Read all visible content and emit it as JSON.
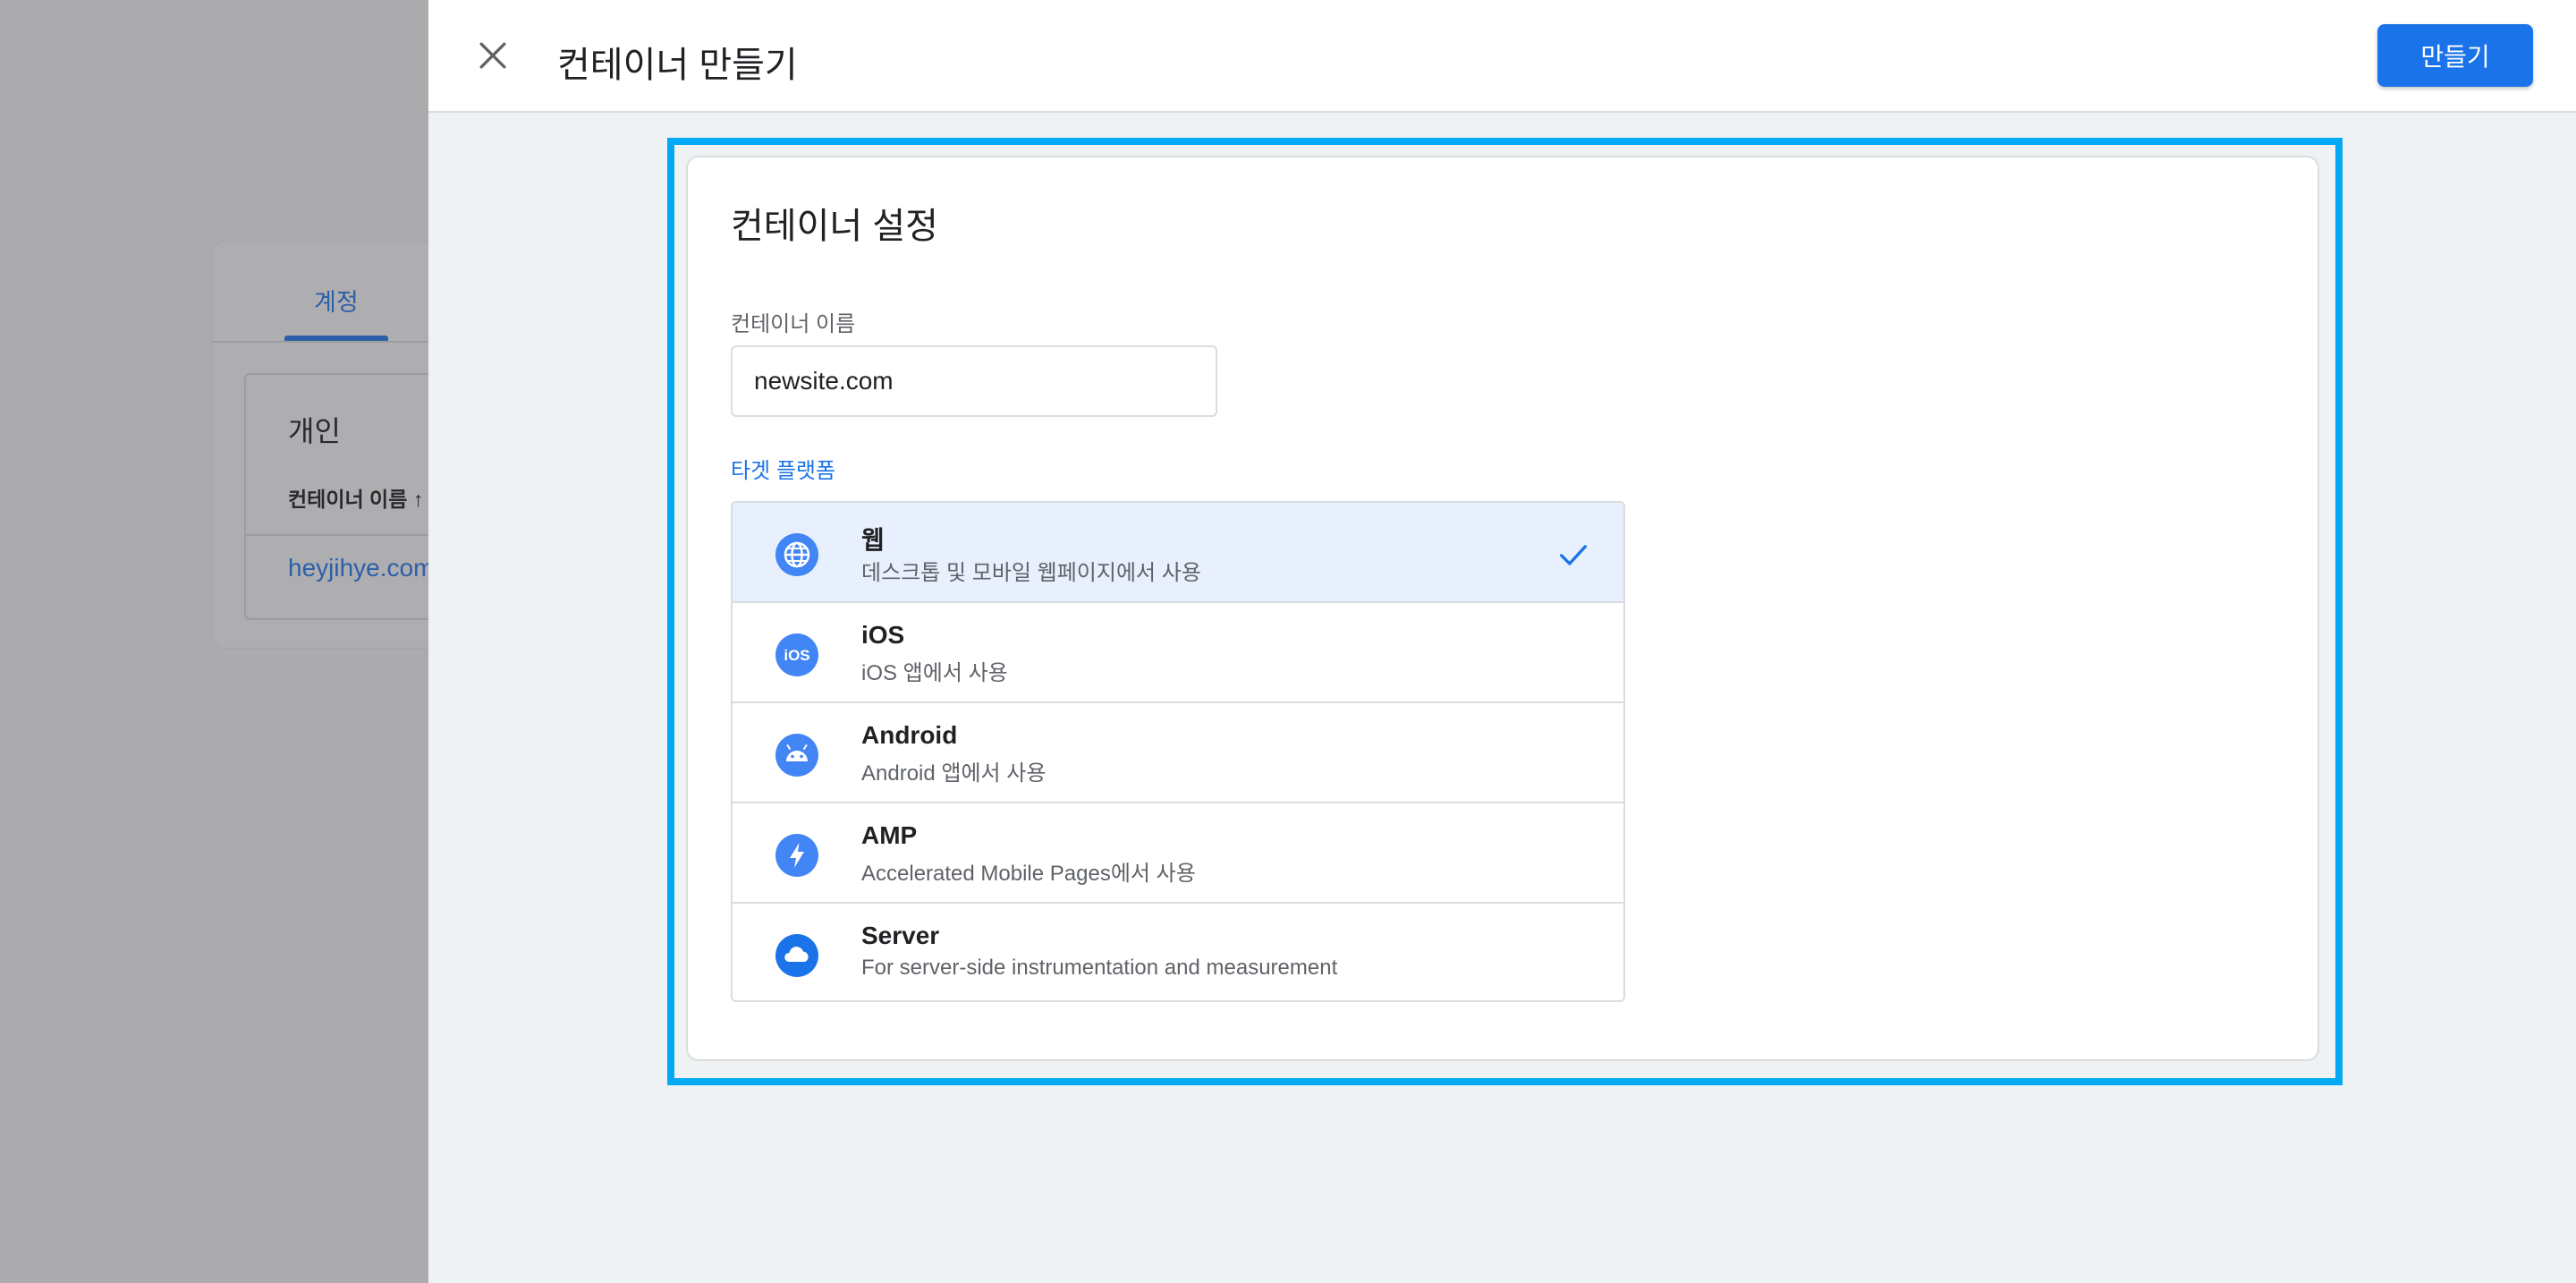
{
  "background": {
    "tab_label": "계정",
    "section_title": "개인",
    "column_header": "컨테이너 이름 ↑",
    "row_link": "heyjihye.com"
  },
  "header": {
    "title": "컨테이너 만들기",
    "create_label": "만들기",
    "close_icon": "close-icon"
  },
  "card": {
    "title": "컨테이너 설정",
    "name_label": "컨테이너 이름",
    "name_value": "newsite.com",
    "platform_label": "타겟 플랫폼",
    "platforms": [
      {
        "name": "웹",
        "desc": "데스크톱 및 모바일 웹페이지에서 사용",
        "icon": "globe-icon",
        "selected": true
      },
      {
        "name": "iOS",
        "desc": "iOS 앱에서 사용",
        "icon": "ios-icon",
        "selected": false
      },
      {
        "name": "Android",
        "desc": "Android 앱에서 사용",
        "icon": "android-icon",
        "selected": false
      },
      {
        "name": "AMP",
        "desc": "Accelerated Mobile Pages에서 사용",
        "icon": "amp-icon",
        "selected": false
      },
      {
        "name": "Server",
        "desc": "For server-side instrumentation and measurement",
        "icon": "cloud-icon",
        "selected": false
      }
    ]
  },
  "colors": {
    "accent": "#1a73e8",
    "highlight": "#03a9f4",
    "selected_bg": "#e8f0fe",
    "icon_blue": "#4285f4"
  }
}
